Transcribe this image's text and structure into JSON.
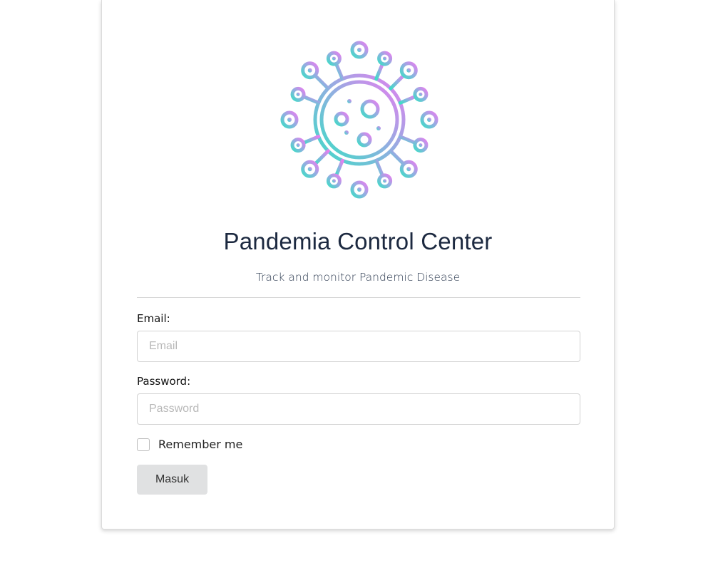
{
  "app": {
    "title": "Pandemia Control Center",
    "subtitle": "Track and monitor Pandemic Disease",
    "logo_icon": "virus-icon"
  },
  "form": {
    "email_label": "Email:",
    "email_placeholder": "Email",
    "email_value": "",
    "password_label": "Password:",
    "password_placeholder": "Password",
    "password_value": "",
    "remember_label": "Remember me",
    "remember_checked": false,
    "submit_label": "Masuk"
  },
  "colors": {
    "title": "#1c2940",
    "gradient_teal": "#3fdcc7",
    "gradient_blue": "#8fb0e0",
    "gradient_pink": "#e57ff0",
    "button_bg": "#e0e1e2"
  }
}
